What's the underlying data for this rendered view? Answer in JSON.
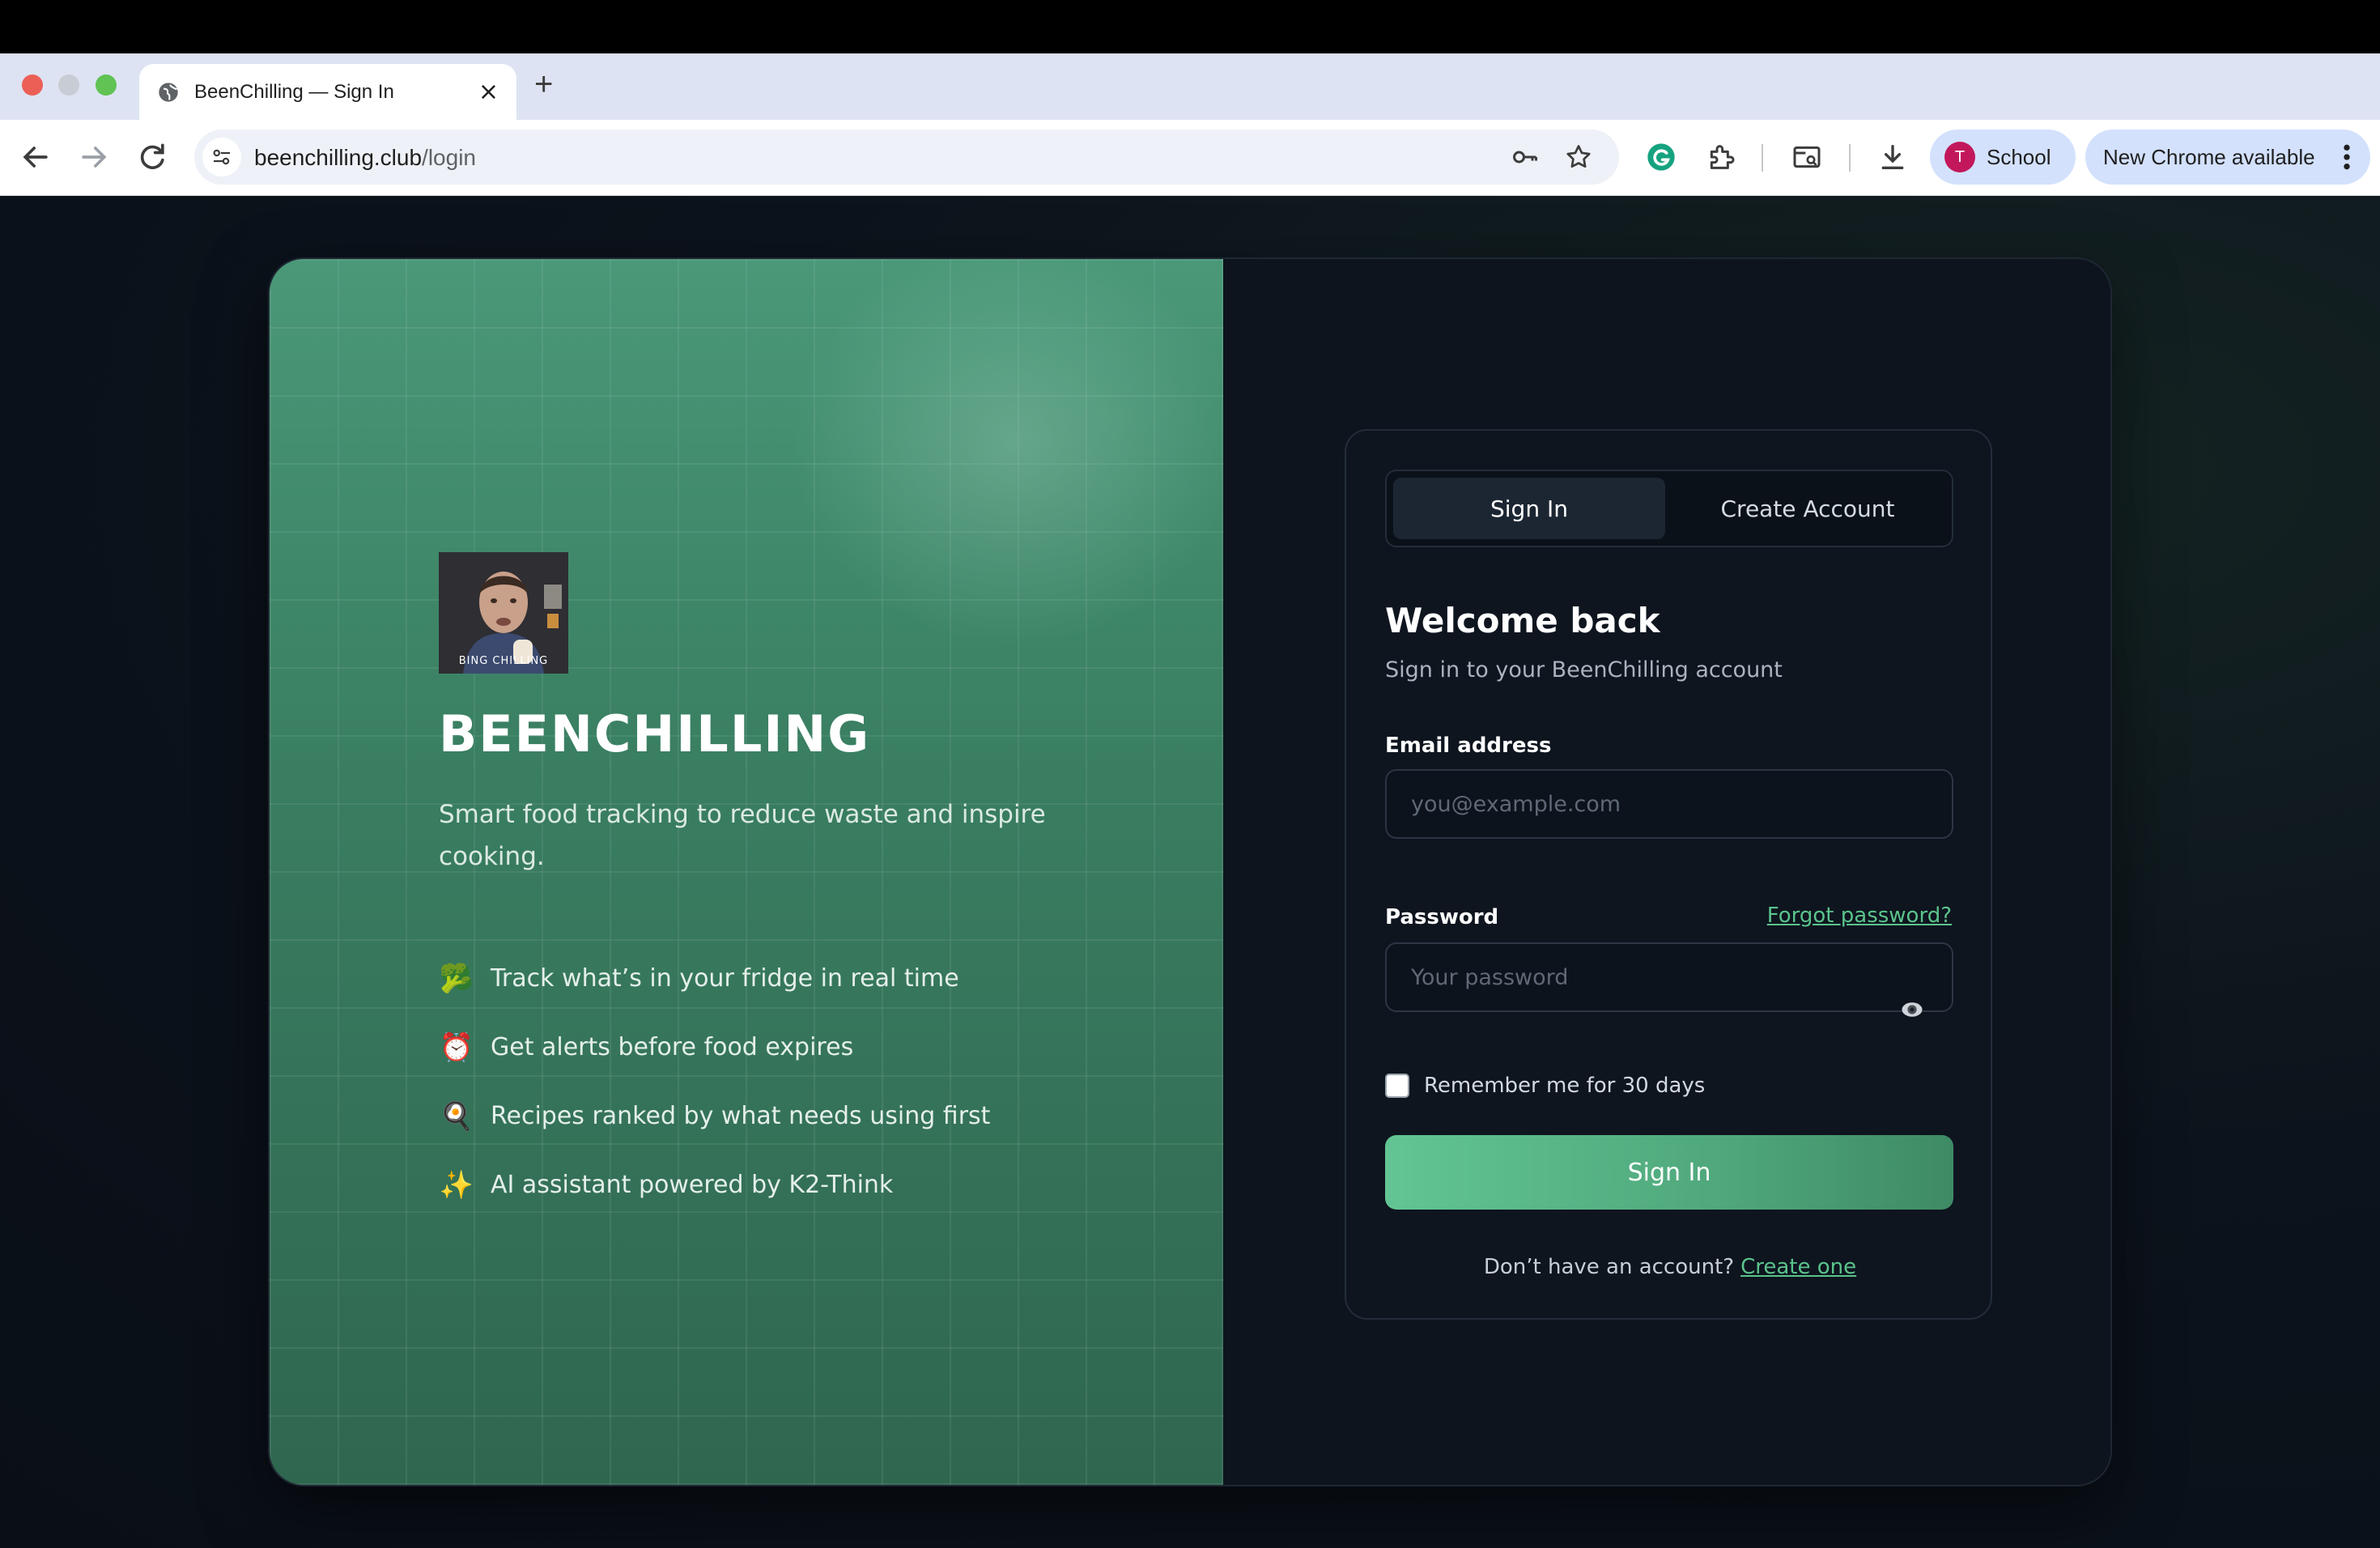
{
  "browser": {
    "tab_title": "BeenChilling — Sign In",
    "tab_close": "×",
    "new_tab": "+",
    "url_host": "beenchilling.club",
    "url_path": "/login",
    "profile_initial": "T",
    "profile_name": "School",
    "update_label": "New Chrome available"
  },
  "hero": {
    "logo_caption": "BING CHILLING",
    "brand": "BEENCHILLING",
    "tagline": "Smart food tracking to reduce waste and inspire cooking.",
    "features": [
      {
        "icon": "🥦",
        "text": "Track what’s in your fridge in real time"
      },
      {
        "icon": "⏰",
        "text": "Get alerts before food expires"
      },
      {
        "icon": "🍳",
        "text": "Recipes ranked by what needs using first"
      },
      {
        "icon": "✨",
        "text": "AI assistant powered by K2-Think"
      }
    ]
  },
  "auth": {
    "tabs": {
      "sign_in": "Sign In",
      "create_account": "Create Account"
    },
    "title": "Welcome back",
    "subtitle": "Sign in to your BeenChilling account",
    "email_label": "Email address",
    "email_placeholder": "you@example.com",
    "password_label": "Password",
    "forgot_label": "Forgot password?",
    "password_placeholder": "Your password",
    "remember_label": "Remember me for 30 days",
    "submit_label": "Sign In",
    "no_account_text": "Don’t have an account?",
    "create_link": "Create one"
  },
  "colors": {
    "accent": "#5bc48c",
    "hero_green": "#3a7f62",
    "panel_bg": "#0d141d"
  }
}
